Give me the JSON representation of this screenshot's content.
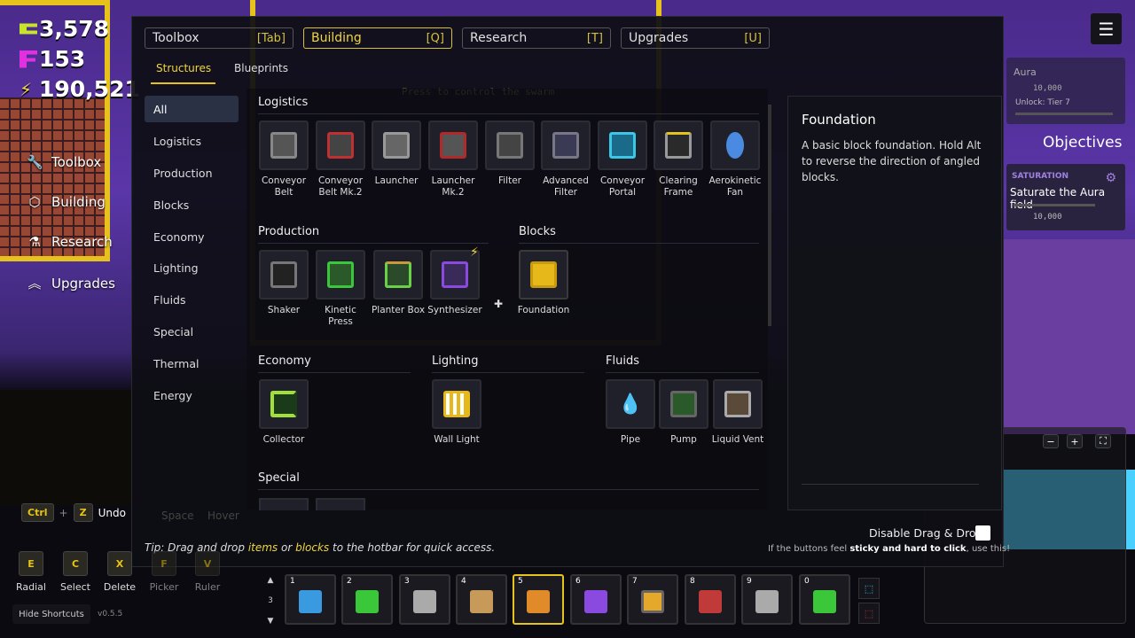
{
  "resources": {
    "credits": "3,578",
    "flux": "153",
    "energy": "190,521"
  },
  "side_menu": [
    {
      "label": "Toolbox",
      "icon": "wrench-icon"
    },
    {
      "label": "Building",
      "icon": "cube-icon"
    },
    {
      "label": "Research",
      "icon": "flask-icon"
    },
    {
      "label": "Upgrades",
      "icon": "chevron-up-icon"
    }
  ],
  "tabs": [
    {
      "label": "Toolbox",
      "key": "[Tab]"
    },
    {
      "label": "Building",
      "key": "[Q]"
    },
    {
      "label": "Research",
      "key": "[T]"
    },
    {
      "label": "Upgrades",
      "key": "[U]"
    }
  ],
  "subtabs": [
    "Structures",
    "Blueprints"
  ],
  "categories": [
    "All",
    "Logistics",
    "Production",
    "Blocks",
    "Economy",
    "Lighting",
    "Fluids",
    "Special",
    "Thermal",
    "Energy"
  ],
  "sections": {
    "logistics": {
      "title": "Logistics",
      "items": [
        "Conveyor Belt",
        "Conveyor Belt Mk.2",
        "Launcher",
        "Launcher Mk.2",
        "Filter",
        "Advanced Filter",
        "Conveyor Portal",
        "Clearing Frame",
        "Aerokinetic Fan"
      ]
    },
    "production": {
      "title": "Production",
      "items": [
        "Shaker",
        "Kinetic Press",
        "Planter Box",
        "Synthesizer"
      ]
    },
    "blocks": {
      "title": "Blocks",
      "items": [
        "Foundation"
      ]
    },
    "economy": {
      "title": "Economy",
      "items": [
        "Collector"
      ]
    },
    "lighting": {
      "title": "Lighting",
      "items": [
        "Wall Light"
      ]
    },
    "fluids": {
      "title": "Fluids",
      "items": [
        "Pipe",
        "Pump",
        "Liquid Vent"
      ]
    },
    "special": {
      "title": "Special"
    }
  },
  "description": {
    "title": "Foundation",
    "text": "A basic block foundation. Hold Alt to reverse the direction of angled blocks."
  },
  "objectives": {
    "title": "Objectives",
    "aura_label": "Aura",
    "aura_value": "10,000",
    "aura_unlock": "Unlock: Tier 7",
    "card_tag": "SATURATION",
    "card_text": "Saturate the Aura field",
    "card_value": "10,000"
  },
  "world_text": {
    "prompt": "Press to control the swarm"
  },
  "tip": {
    "prefix": "Tip: Drag and drop ",
    "items": "items",
    "mid": " or ",
    "blocks": "blocks",
    "suffix": " to the hotbar for quick access."
  },
  "drag_drop": {
    "label": "Disable Drag & Drop",
    "note_prefix": "If the buttons feel ",
    "note_bold": "sticky and hard to click",
    "note_suffix": ", use this!"
  },
  "shortcuts": {
    "ctrl": "Ctrl",
    "plus": "+",
    "z": "Z",
    "undo": "Undo",
    "space": "Space",
    "hover": "Hover",
    "tools": [
      {
        "key": "E",
        "label": "Radial"
      },
      {
        "key": "C",
        "label": "Select"
      },
      {
        "key": "X",
        "label": "Delete"
      },
      {
        "key": "F",
        "label": "Picker"
      },
      {
        "key": "V",
        "label": "Ruler"
      }
    ],
    "hide": "Hide Shortcuts",
    "version": "v0.5.5"
  },
  "hotbar": {
    "page": "3",
    "slots": [
      "1",
      "2",
      "3",
      "4",
      "5",
      "6",
      "7",
      "8",
      "9",
      "0"
    ],
    "selected": "5"
  },
  "colors": {
    "accent": "#e6c21a",
    "panel": "#0e0e14",
    "sky": "#5a36a8"
  }
}
